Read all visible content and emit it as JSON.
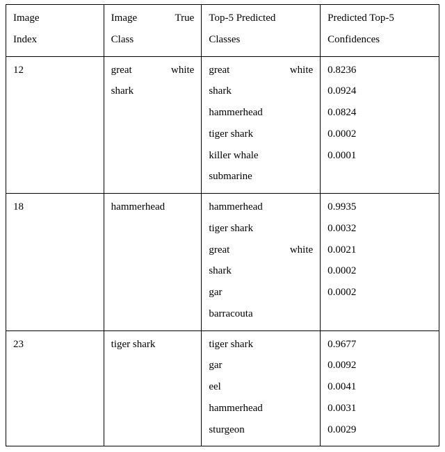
{
  "headers": {
    "col0_l0_a": "Image",
    "col0_l1": "Index",
    "col1_l0_a": "Image",
    "col1_l0_b": "True",
    "col1_l1": "Class",
    "col2_l0": "Top-5 Predicted",
    "col2_l1": "Classes",
    "col3_l0": "Predicted Top-5",
    "col3_l1": "Confidences"
  },
  "rows": [
    {
      "index": "12",
      "true_class_lines": [
        {
          "type": "j",
          "a": "great",
          "b": "white"
        },
        {
          "type": "p",
          "t": "shark"
        }
      ],
      "pred_lines": [
        {
          "type": "j",
          "a": "great",
          "b": "white"
        },
        {
          "type": "p",
          "t": "shark"
        },
        {
          "type": "p",
          "t": "hammerhead"
        },
        {
          "type": "p",
          "t": "tiger shark"
        },
        {
          "type": "p",
          "t": "killer whale"
        },
        {
          "type": "p",
          "t": "submarine"
        }
      ],
      "conf_lines": [
        "0.8236",
        "0.0924",
        "0.0824",
        "0.0002",
        "0.0001"
      ]
    },
    {
      "index": "18",
      "true_class_lines": [
        {
          "type": "p",
          "t": "hammerhead"
        }
      ],
      "pred_lines": [
        {
          "type": "p",
          "t": "hammerhead"
        },
        {
          "type": "p",
          "t": "tiger shark"
        },
        {
          "type": "j",
          "a": "great",
          "b": "white"
        },
        {
          "type": "p",
          "t": "shark"
        },
        {
          "type": "p",
          "t": "gar"
        },
        {
          "type": "p",
          "t": "barracouta"
        }
      ],
      "conf_lines": [
        "0.9935",
        "0.0032",
        "0.0021",
        "0.0002",
        "0.0002"
      ]
    },
    {
      "index": "23",
      "true_class_lines": [
        {
          "type": "p",
          "t": "tiger shark"
        }
      ],
      "pred_lines": [
        {
          "type": "p",
          "t": "tiger shark"
        },
        {
          "type": "p",
          "t": "gar"
        },
        {
          "type": "p",
          "t": "eel"
        },
        {
          "type": "p",
          "t": "hammerhead"
        },
        {
          "type": "p",
          "t": "sturgeon"
        }
      ],
      "conf_lines": [
        "0.9677",
        "0.0092",
        "0.0041",
        "0.0031",
        "0.0029"
      ]
    }
  ]
}
